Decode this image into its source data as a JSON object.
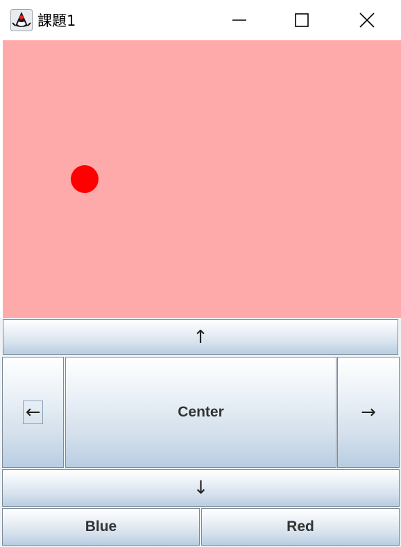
{
  "window": {
    "title": "課題1",
    "app_icon": "java-duke-icon",
    "controls": {
      "minimize_icon": "minimize-icon",
      "maximize_icon": "maximize-icon",
      "close_icon": "close-icon"
    }
  },
  "canvas": {
    "background": "#ffaaaa",
    "ball_color": "#ff0000"
  },
  "controls": {
    "up_label": "↑",
    "left_label": "←",
    "center_label": "Center",
    "right_label": "→",
    "down_label": "↓",
    "blue_label": "Blue",
    "red_label": "Red"
  }
}
